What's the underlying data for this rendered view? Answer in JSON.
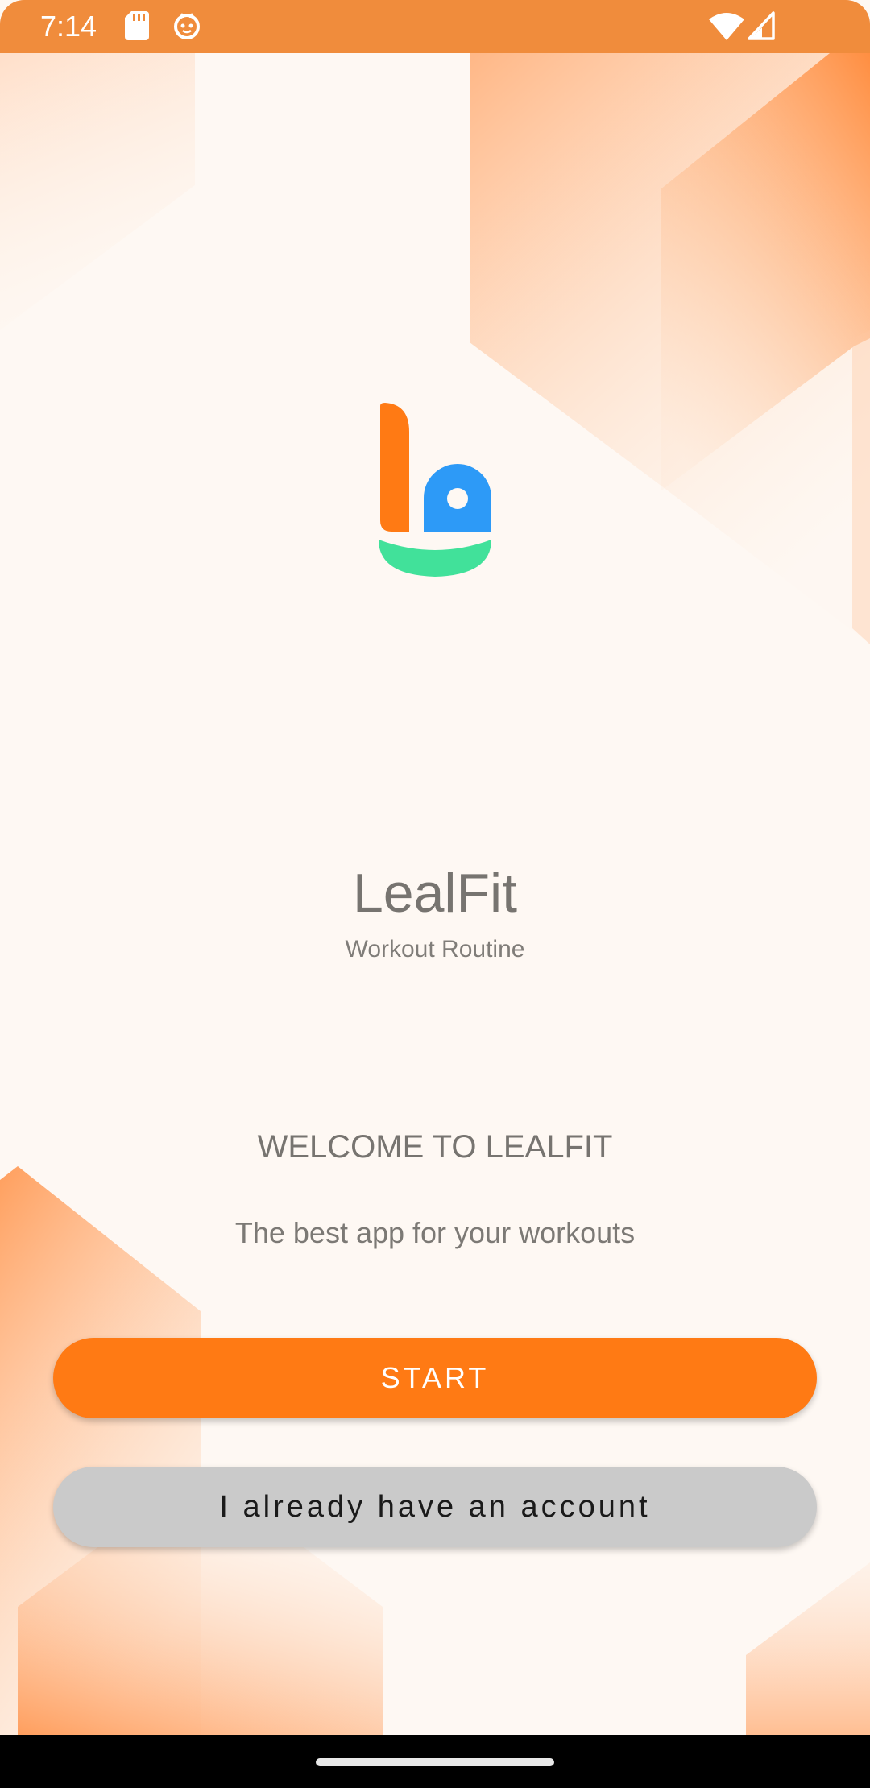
{
  "status_bar": {
    "time": "7:14",
    "icons": [
      "sd-card-icon",
      "cat-notification-icon",
      "wifi-icon",
      "signal-icon"
    ]
  },
  "app": {
    "name": "LealFit",
    "subtitle": "Workout Routine"
  },
  "welcome": {
    "heading": "WELCOME TO LEALFIT",
    "tagline": "The best app for your workouts"
  },
  "buttons": {
    "start_label": "START",
    "account_label": "I already have an account"
  },
  "colors": {
    "status_bar": "#F08C3C",
    "background": "#FEF8F3",
    "primary_button": "#FF7A14",
    "secondary_button": "#CACACA",
    "logo_orange": "#FF7A14",
    "logo_blue": "#2D9AF7",
    "logo_green": "#41E19A"
  }
}
